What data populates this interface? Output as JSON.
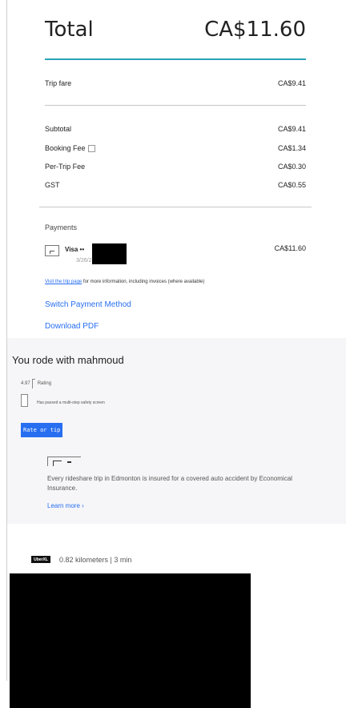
{
  "receipt": {
    "total_label": "Total",
    "total_amount": "CA$11.60",
    "trip_fare": {
      "label": "Trip fare",
      "amount": "CA$9.41"
    },
    "lines": [
      {
        "label": "Subtotal",
        "amount": "CA$9.41"
      },
      {
        "label": "Booking Fee",
        "amount": "CA$1.34"
      },
      {
        "label": "Per-Trip Fee",
        "amount": "CA$0.30"
      },
      {
        "label": "GST",
        "amount": "CA$0.55"
      }
    ],
    "accent_color": "#2aa3b7"
  },
  "payments": {
    "title": "Payments",
    "card_label": "Visa ••",
    "card_date": "3/26/24",
    "amount": "CA$11.60"
  },
  "links": {
    "trip_page_link": "Visit the trip page",
    "trip_page_note": " for more information, including invoices (where available)",
    "switch_payment": "Switch Payment Method",
    "download_pdf": "Download PDF",
    "link_color": "#276ef1"
  },
  "driver": {
    "rode_with": "You rode with mahmoud",
    "rating_value": "4.97",
    "rating_label": "Rating",
    "safety_screen": "Has passed a multi-step safety screen",
    "rate_button": "Rate or tip"
  },
  "insurance": {
    "text": "Every rideshare trip in Edmonton is insured for a covered auto accident by Economical Insurance.",
    "learn_more": "Learn more ›"
  },
  "trip": {
    "vehicle_type": "UberXL",
    "distance_time": "0.82 kilometers | 3 min"
  }
}
